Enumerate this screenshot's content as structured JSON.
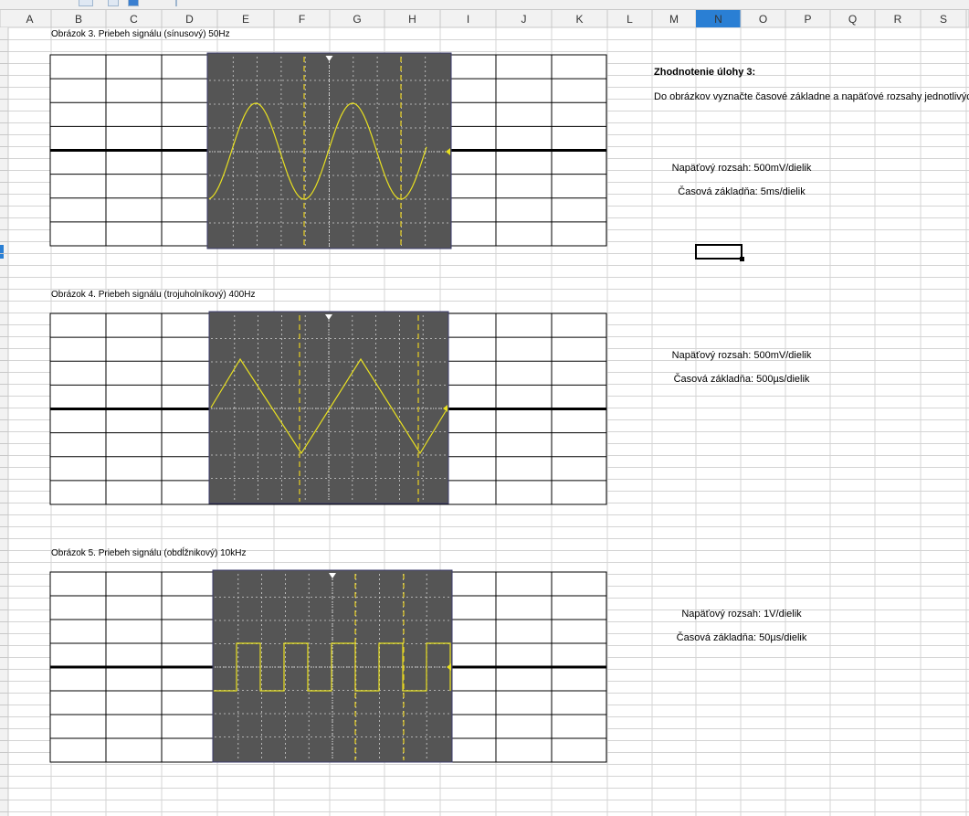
{
  "columns": [
    "A",
    "B",
    "C",
    "D",
    "E",
    "F",
    "G",
    "H",
    "I",
    "J",
    "K",
    "L",
    "M",
    "N",
    "O",
    "P",
    "Q",
    "R",
    "S"
  ],
  "active_column": "N",
  "colors": {
    "scope_bg": "#555555",
    "trace": "#e8e020",
    "cursor_line": "#e8d020",
    "header_bg": "#f2f2f2",
    "header_active": "#2a7fd4",
    "gridline": "#d4d4d4"
  },
  "figures": [
    {
      "caption": "Obrázok 3. Priebeh signálu (sínusový) 50Hz",
      "waveform": "sine",
      "voltage_range": "Napäťový rozsah: 500mV/dielik",
      "time_base": "Časová základňa: 5ms/dielik"
    },
    {
      "caption": "Obrázok 4. Priebeh signálu (trojuholníkový) 400Hz",
      "waveform": "triangle",
      "voltage_range": "Napäťový rozsah: 500mV/dielik",
      "time_base": "Časová základňa: 500µs/dielik"
    },
    {
      "caption": "Obrázok 5. Priebeh signálu (obdĺžnikový) 10kHz",
      "waveform": "square",
      "voltage_range": "Napäťový rozsah: 1V/dielik",
      "time_base": "Časová základňa: 50µs/dielik"
    }
  ],
  "evaluation": {
    "title": "Zhodnotenie úlohy 3:",
    "instruction": "Do obrázkov vyznačte časové základne a napäťové rozsahy jednotlivých"
  }
}
